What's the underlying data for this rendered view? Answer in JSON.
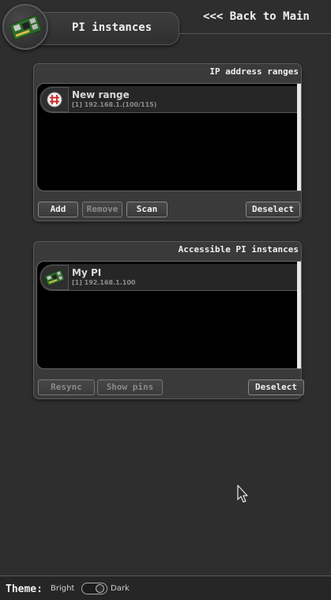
{
  "header": {
    "title": "PI instances",
    "back_label": "<<< Back to Main",
    "logo_icon": "raspberry-pi-board-icon"
  },
  "ip_ranges_panel": {
    "title": "IP address ranges",
    "items": [
      {
        "name": "New range",
        "detail": "[1] 192.168.1.(100/115)",
        "icon": "range-grid-icon"
      }
    ],
    "buttons": {
      "add": "Add",
      "remove": "Remove",
      "scan": "Scan",
      "deselect": "Deselect"
    }
  },
  "instances_panel": {
    "title": "Accessible PI instances",
    "items": [
      {
        "name": "My PI",
        "detail": "[1] 192.168.1.100",
        "icon": "raspberry-pi-board-icon"
      }
    ],
    "buttons": {
      "resync": "Resync",
      "show_pins": "Show pins",
      "deselect": "Deselect"
    }
  },
  "footer": {
    "theme_label": "Theme:",
    "bright_label": "Bright",
    "dark_label": "Dark",
    "theme_selected": "Dark"
  },
  "colors": {
    "background": "#2e2e2e",
    "panel": "#3a3a3a",
    "list_background": "#000000",
    "range_icon_accent": "#cc2222"
  }
}
